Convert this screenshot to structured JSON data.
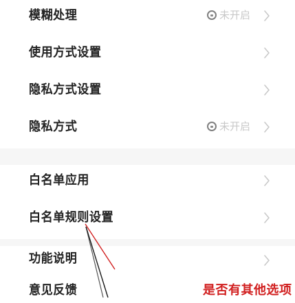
{
  "settings": {
    "items": [
      {
        "label": "模糊处理",
        "control": "toggle",
        "toggle_text": "未开启"
      },
      {
        "label": "使用方式设置",
        "control": "chevron"
      },
      {
        "label": "隐私方式设置",
        "control": "chevron"
      },
      {
        "label": "隐私方式",
        "control": "toggle",
        "toggle_text": "未开启"
      },
      {
        "label": "白名单应用",
        "control": "chevron"
      },
      {
        "label": "白名单规则设置",
        "control": "chevron"
      },
      {
        "label": "功能说明",
        "control": "chevron"
      },
      {
        "label": "意见反馈",
        "control": "chevron"
      }
    ]
  },
  "annotation": {
    "text": "是否有其他选项"
  },
  "colors": {
    "annotation": "#d11f1f",
    "label": "#222222",
    "chevron": "#c9c9c9",
    "toggle_text": "#c8c8c8",
    "divider": "#f6f6f6"
  }
}
